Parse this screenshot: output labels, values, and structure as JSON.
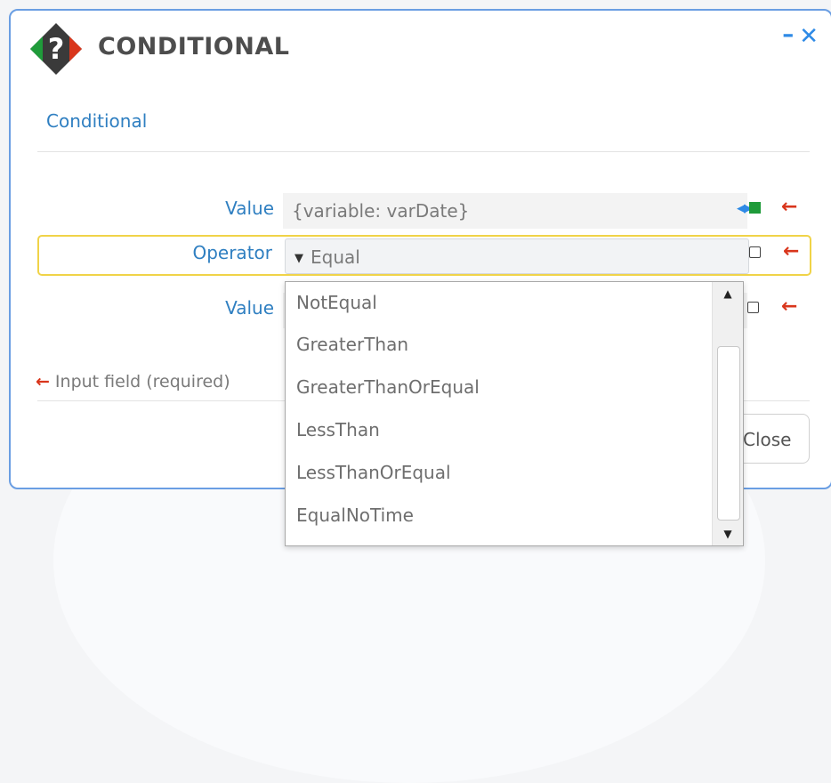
{
  "dialog": {
    "title": "CONDITIONAL",
    "section_label": "Conditional",
    "icons": {
      "logo": "question-diamond-icon",
      "minimize": "minimize-icon",
      "close": "close-icon"
    }
  },
  "fields": [
    {
      "label": "Value",
      "value": "{variable: varDate}",
      "type": "text"
    },
    {
      "label": "Operator",
      "value": "Equal",
      "type": "select"
    },
    {
      "label": "Value",
      "value": "",
      "type": "text"
    }
  ],
  "hint": "Input field (required)",
  "close_label": "Close",
  "dropdown": {
    "options": [
      "NotEqual",
      "GreaterThan",
      "GreaterThanOrEqual",
      "LessThan",
      "LessThanOrEqual",
      "EqualNoTime"
    ]
  },
  "colors": {
    "accent": "#2f7fc1",
    "border": "#6a9ee3",
    "highlight": "#f0d348",
    "required_arrow": "#d9361c",
    "green_indicator": "#1f9b3a"
  }
}
